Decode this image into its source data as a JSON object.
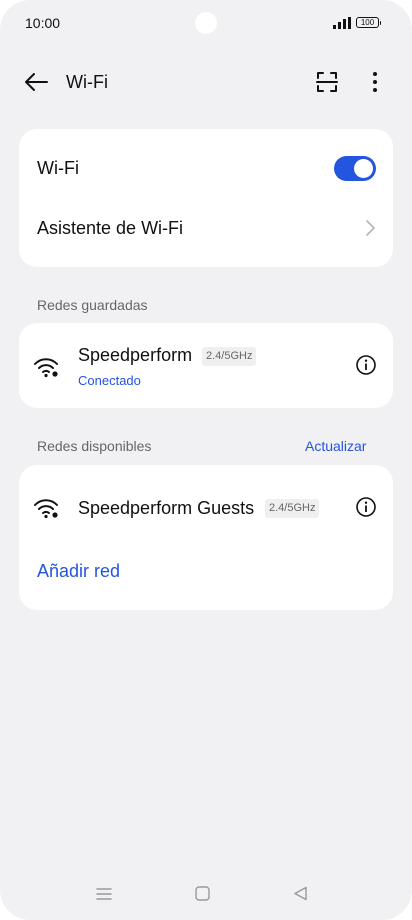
{
  "status_bar": {
    "time": "10:00",
    "battery": "100"
  },
  "header": {
    "title": "Wi-Fi"
  },
  "wifi_card": {
    "wifi_label": "Wi-Fi",
    "wifi_enabled": true,
    "assistant_label": "Asistente de Wi-Fi"
  },
  "saved_networks": {
    "section_label": "Redes guardadas",
    "items": [
      {
        "name": "Speedperform",
        "band": "2.4/5GHz",
        "status": "Conectado"
      }
    ]
  },
  "available_networks": {
    "section_label": "Redes disponibles",
    "refresh_label": "Actualizar",
    "items": [
      {
        "name": "Speedperform Guests",
        "band": "2.4/5GHz"
      }
    ],
    "add_network_label": "Añadir red"
  },
  "colors": {
    "accent": "#2455e0",
    "background": "#f1f1f3",
    "card": "#ffffff"
  },
  "icons": [
    "back-arrow-icon",
    "qr-scan-icon",
    "more-vertical-icon",
    "wifi-icon",
    "info-icon",
    "chevron-right-icon",
    "menu-icon",
    "home-square-icon",
    "back-triangle-icon"
  ]
}
